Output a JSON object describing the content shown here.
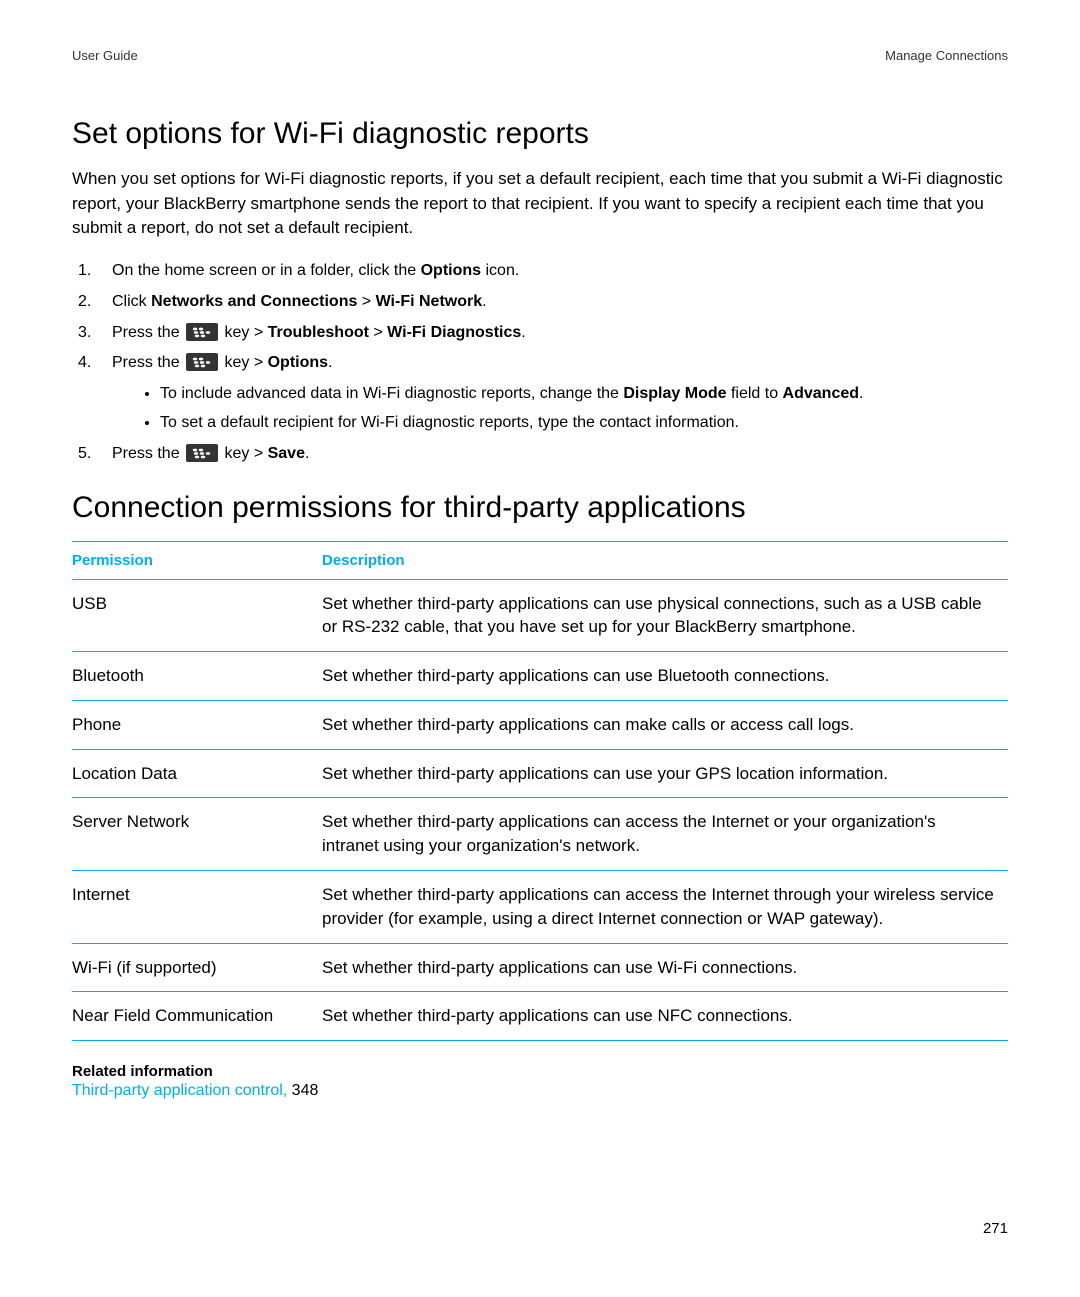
{
  "header": {
    "left": "User Guide",
    "right": "Manage Connections"
  },
  "section1": {
    "heading": "Set options for Wi-Fi diagnostic reports",
    "intro": "When you set options for Wi-Fi diagnostic reports, if you set a default recipient, each time that you submit a Wi-Fi diagnostic report, your BlackBerry smartphone sends the report to that recipient. If you want to specify a recipient each time that you submit a report, do not set a default recipient.",
    "steps": {
      "s1_a": "On the home screen or in a folder, click the ",
      "s1_b": "Options",
      "s1_c": " icon.",
      "s2_a": "Click ",
      "s2_b": "Networks and Connections",
      "s2_gt": " > ",
      "s2_c": "Wi-Fi Network",
      "s2_d": ".",
      "s3_a": "Press the ",
      "s3_b": " key > ",
      "s3_c": "Troubleshoot",
      "s3_gt": " > ",
      "s3_d": "Wi-Fi Diagnostics",
      "s3_e": ".",
      "s4_a": "Press the ",
      "s4_b": " key > ",
      "s4_c": "Options",
      "s4_d": ".",
      "sub1_a": "To include advanced data in Wi-Fi diagnostic reports, change the ",
      "sub1_b": "Display Mode",
      "sub1_c": " field to ",
      "sub1_d": "Advanced",
      "sub1_e": ".",
      "sub2": "To set a default recipient for Wi-Fi diagnostic reports, type the contact information.",
      "s5_a": "Press the ",
      "s5_b": " key > ",
      "s5_c": "Save",
      "s5_d": "."
    }
  },
  "section2": {
    "heading": "Connection permissions for third-party applications",
    "table": {
      "h1": "Permission",
      "h2": "Description",
      "rows": [
        {
          "p": "USB",
          "d": "Set whether third-party applications can use physical connections, such as a USB cable or RS-232 cable, that you have set up for your BlackBerry smartphone."
        },
        {
          "p": "Bluetooth",
          "d": "Set whether third-party applications can use Bluetooth connections."
        },
        {
          "p": "Phone",
          "d": "Set whether third-party applications can make calls or access call logs."
        },
        {
          "p": "Location Data",
          "d": "Set whether third-party applications can use your GPS location information."
        },
        {
          "p": "Server Network",
          "d": "Set whether third-party applications can access the Internet or your organization's intranet using your organization's network."
        },
        {
          "p": "Internet",
          "d": "Set whether third-party applications can access the Internet through your wireless service provider (for example, using a direct Internet connection or WAP gateway)."
        },
        {
          "p": "Wi-Fi (if supported)",
          "d": "Set whether third-party applications can use Wi-Fi connections."
        },
        {
          "p": "Near Field Communication",
          "d": "Set whether third-party applications can use NFC connections."
        }
      ]
    }
  },
  "related": {
    "heading": "Related information",
    "link": "Third-party application control,",
    "num": " 348"
  },
  "pagenum": "271"
}
